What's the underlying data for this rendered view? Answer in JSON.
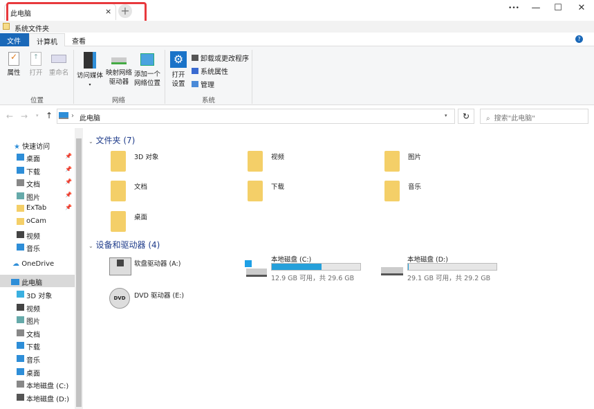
{
  "tab": {
    "title": "此电脑",
    "close": "×",
    "new_tab": "+"
  },
  "window": {
    "more": "•••",
    "minimize": "—",
    "maximize": "☐",
    "close": "✕"
  },
  "bookmark": {
    "label": "系统文件夹"
  },
  "ribbon_tabs": [
    {
      "label": "文件"
    },
    {
      "label": "计算机"
    },
    {
      "label": "查看"
    }
  ],
  "help": "?",
  "ribbon": {
    "location": {
      "group": "位置",
      "items": [
        "属性",
        "打开",
        "重命名"
      ]
    },
    "network": {
      "group": "网络",
      "items": [
        "访问媒体",
        "映射网络\n驱动器",
        "添加一个\n网络位置"
      ]
    },
    "system": {
      "group": "系统",
      "open_settings": "打开\n设置",
      "items": [
        "卸载或更改程序",
        "系统属性",
        "管理"
      ]
    }
  },
  "address": {
    "path": "此电脑",
    "search_placeholder": "搜索\"此电脑\""
  },
  "nav": {
    "quick_access": "快速访问",
    "quick": [
      "桌面",
      "下载",
      "文档",
      "图片",
      "ExTab",
      "oCam",
      "视频",
      "音乐"
    ],
    "onedrive": "OneDrive",
    "this_pc": "此电脑",
    "pc": [
      "3D 对象",
      "视频",
      "图片",
      "文档",
      "下载",
      "音乐",
      "桌面",
      "本地磁盘 (C:)",
      "本地磁盘 (D:)"
    ]
  },
  "folders": {
    "header": "文件夹 (7)",
    "items": [
      "3D 对象",
      "视频",
      "图片",
      "文档",
      "下载",
      "音乐",
      "桌面"
    ]
  },
  "devices": {
    "header": "设备和驱动器 (4)",
    "floppy": "软盘驱动器 (A:)",
    "dvd": "DVD 驱动器 (E:)",
    "c": {
      "name": "本地磁盘 (C:)",
      "info": "12.9 GB 可用，共 29.6 GB",
      "used_percent": 56.4
    },
    "d": {
      "name": "本地磁盘 (D:)",
      "info": "29.1 GB 可用，共 29.2 GB",
      "used_percent": 0.3
    }
  }
}
